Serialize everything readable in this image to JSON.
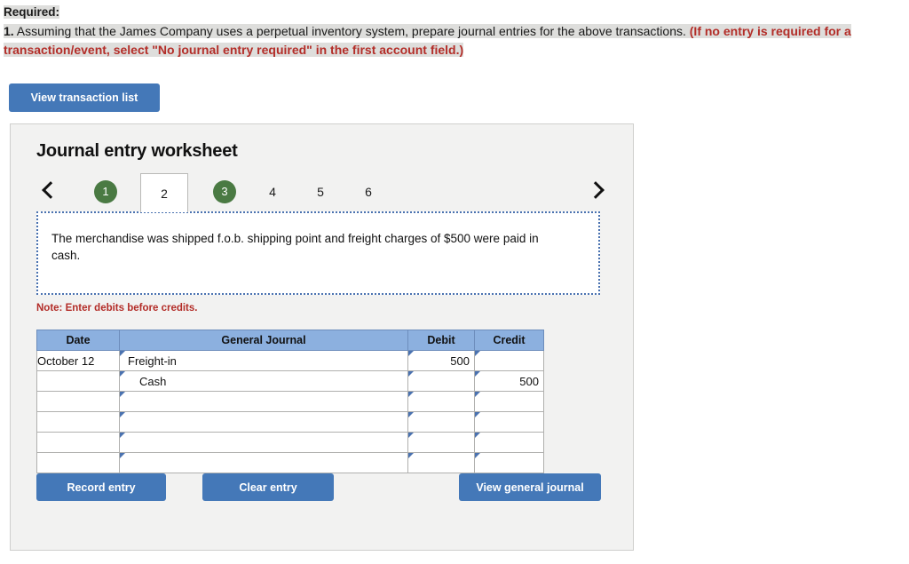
{
  "instructions": {
    "required_label": "Required:",
    "item_number": "1.",
    "body": " Assuming that the James Company uses a perpetual inventory system, prepare journal entries for the above transactions. ",
    "parenthetical": "(If no entry is required for a transaction/event, select \"No journal entry required\" in the first account field.)"
  },
  "top_actions": {
    "view_transaction_list": "View transaction list"
  },
  "worksheet": {
    "title": "Journal entry worksheet",
    "nav": {
      "prev_icon": "chevron-left-icon",
      "next_icon": "chevron-right-icon"
    },
    "tabs": [
      {
        "label": "1",
        "state": "complete"
      },
      {
        "label": "2",
        "state": "active"
      },
      {
        "label": "3",
        "state": "complete"
      },
      {
        "label": "4",
        "state": "default"
      },
      {
        "label": "5",
        "state": "default"
      },
      {
        "label": "6",
        "state": "default"
      }
    ],
    "transaction_text": "The merchandise was shipped f.o.b. shipping point and freight charges of $500 were paid in cash.",
    "note": "Note: Enter debits before credits.",
    "table": {
      "headers": [
        "Date",
        "General Journal",
        "Debit",
        "Credit"
      ],
      "rows": [
        {
          "date": "October 12",
          "account": "Freight-in",
          "indent": false,
          "debit": "500",
          "credit": ""
        },
        {
          "date": "",
          "account": "Cash",
          "indent": true,
          "debit": "",
          "credit": "500"
        },
        {
          "date": "",
          "account": "",
          "indent": false,
          "debit": "",
          "credit": ""
        },
        {
          "date": "",
          "account": "",
          "indent": false,
          "debit": "",
          "credit": ""
        },
        {
          "date": "",
          "account": "",
          "indent": false,
          "debit": "",
          "credit": ""
        },
        {
          "date": "",
          "account": "",
          "indent": false,
          "debit": "",
          "credit": ""
        }
      ]
    },
    "footer_actions": {
      "record_entry": "Record entry",
      "clear_entry": "Clear entry",
      "view_general_journal": "View general journal"
    }
  },
  "colors": {
    "button_blue": "#4478b8",
    "tab_green": "#4a7a43",
    "header_blue": "#8cb0df",
    "input_border_blue": "#4a72b0",
    "alert_red": "#b32d28",
    "panel_gray": "#f2f2f1"
  }
}
